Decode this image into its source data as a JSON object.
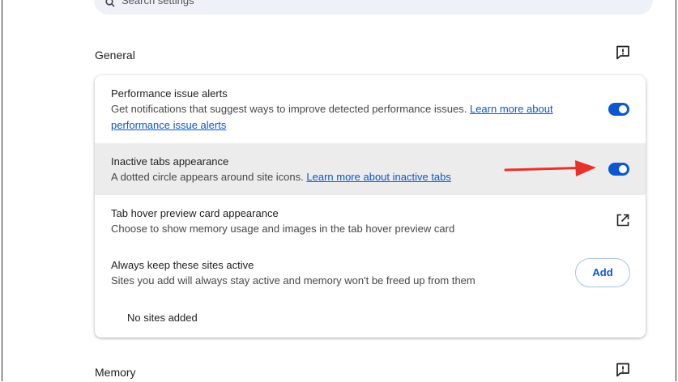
{
  "search": {
    "placeholder": "Search settings"
  },
  "general": {
    "title": "General",
    "feedback_icon": "feedback-icon",
    "performance_alerts": {
      "title": "Performance issue alerts",
      "desc": "Get notifications that suggest ways to improve detected performance issues.",
      "link_line1": "Learn more about",
      "link_line2": "performance issue alerts",
      "enabled": true
    },
    "inactive_tabs": {
      "title": "Inactive tabs appearance",
      "desc": "A dotted circle appears around site icons.",
      "link": "Learn more about inactive tabs",
      "enabled": true
    },
    "hover_preview": {
      "title": "Tab hover preview card appearance",
      "desc": "Choose to show memory usage and images in the tab hover preview card",
      "icon": "open-in-new-icon"
    },
    "keep_active": {
      "title": "Always keep these sites active",
      "desc": "Sites you add will always stay active and memory won't be freed up from them",
      "add_label": "Add",
      "empty_text": "No sites added"
    }
  },
  "memory": {
    "title": "Memory"
  },
  "annotation": {
    "arrow_color": "#e8312a"
  },
  "colors": {
    "accent": "#0b57d0",
    "highlight": "#ececec"
  }
}
